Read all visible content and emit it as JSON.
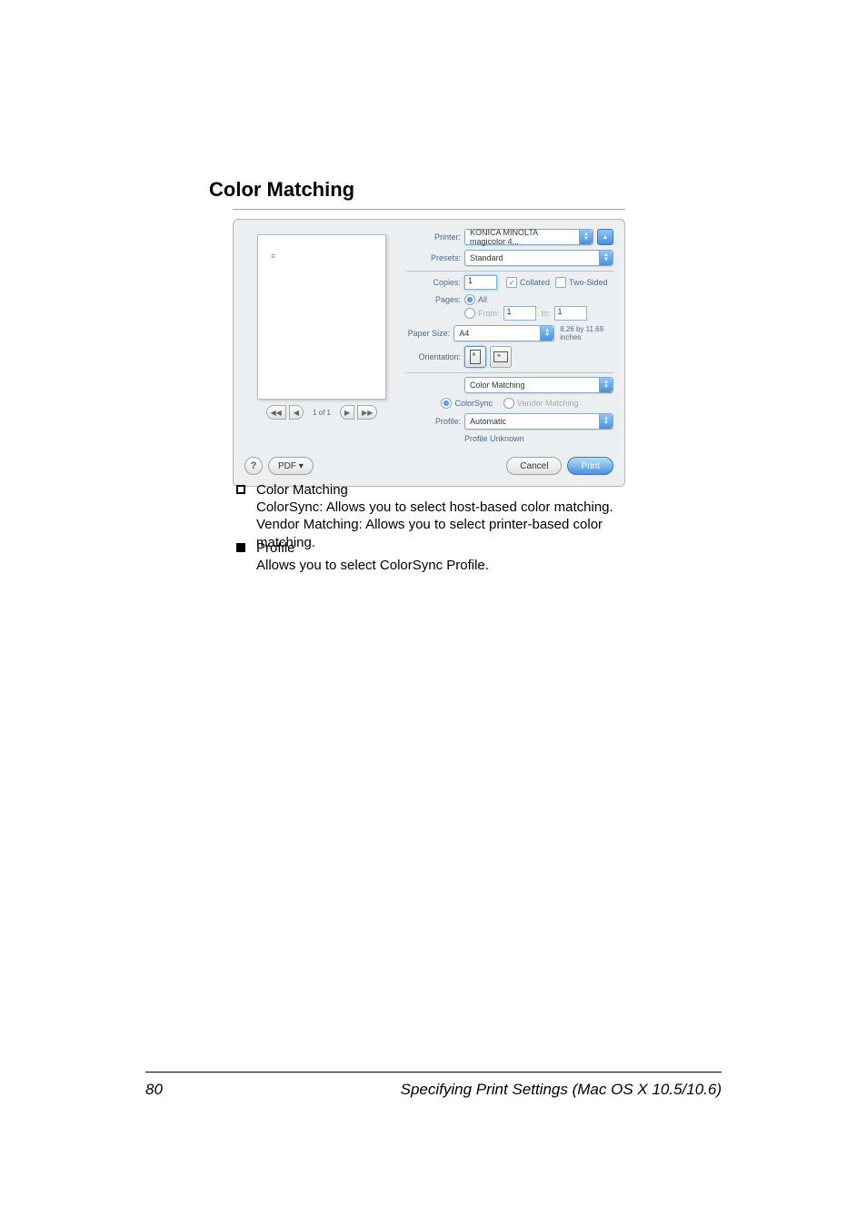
{
  "heading": "Color Matching",
  "dialog": {
    "printer_label": "Printer:",
    "printer_value": "KONICA MINOLTA magicolor 4...",
    "presets_label": "Presets:",
    "presets_value": "Standard",
    "copies_label": "Copies:",
    "copies_value": "1",
    "collated_label": "Collated",
    "twosided_label": "Two-Sided",
    "pages_label": "Pages:",
    "pages_all_label": "All",
    "pages_from_label": "From:",
    "pages_from_value": "1",
    "pages_to_label": "to:",
    "pages_to_value": "1",
    "papersize_label": "Paper Size:",
    "papersize_value": "A4",
    "papersize_info": "8.26 by 11.69 inches",
    "orientation_label": "Orientation:",
    "section_value": "Color Matching",
    "colorsync_label": "ColorSync",
    "vendor_label": "Vendor Matching",
    "profile_label": "Profile:",
    "profile_value": "Automatic",
    "profile_status": "Profile Unknown",
    "nav_first": "◀◀",
    "nav_prev": "◀",
    "nav_pagecount": "1 of 1",
    "nav_next": "▶",
    "nav_last": "▶▶",
    "help_glyph": "?",
    "pdf_label": "PDF ▾",
    "cancel_label": "Cancel",
    "print_label": "Print"
  },
  "bullets": {
    "b1_title": "Color Matching",
    "b1_l1": "ColorSync: Allows you to select host-based color matching.",
    "b1_l2": "Vendor Matching: Allows you to select printer-based color matching.",
    "b2_title": "Profile",
    "b2_l1": "Allows you to select ColorSync Profile."
  },
  "footer": {
    "page": "80",
    "text": "Specifying Print Settings (Mac OS X 10.5/10.6)"
  }
}
